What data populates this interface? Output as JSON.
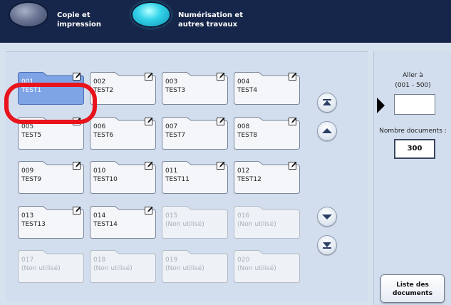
{
  "header": {
    "copy_tab": "Copie et\nimpression",
    "scan_tab": "Numérisation et\nautres travaux"
  },
  "folders": [
    {
      "num": "001",
      "name": "TEST1",
      "state": "selected"
    },
    {
      "num": "002",
      "name": "TEST2",
      "state": "used"
    },
    {
      "num": "003",
      "name": "TEST3",
      "state": "used"
    },
    {
      "num": "004",
      "name": "TEST4",
      "state": "used"
    },
    {
      "num": "005",
      "name": "TEST5",
      "state": "used"
    },
    {
      "num": "006",
      "name": "TEST6",
      "state": "used"
    },
    {
      "num": "007",
      "name": "TEST7",
      "state": "used"
    },
    {
      "num": "008",
      "name": "TEST8",
      "state": "used"
    },
    {
      "num": "009",
      "name": "TEST9",
      "state": "used"
    },
    {
      "num": "010",
      "name": "TEST10",
      "state": "used"
    },
    {
      "num": "011",
      "name": "TEST11",
      "state": "used"
    },
    {
      "num": "012",
      "name": "TEST12",
      "state": "used"
    },
    {
      "num": "013",
      "name": "TEST13",
      "state": "used"
    },
    {
      "num": "014",
      "name": "TEST14",
      "state": "used"
    },
    {
      "num": "015",
      "name": "(Non utilisé)",
      "state": "unused"
    },
    {
      "num": "016",
      "name": "(Non utilisé)",
      "state": "unused"
    },
    {
      "num": "017",
      "name": "(Non utilisé)",
      "state": "unused"
    },
    {
      "num": "018",
      "name": "(Non utilisé)",
      "state": "unused"
    },
    {
      "num": "019",
      "name": "(Non utilisé)",
      "state": "unused"
    },
    {
      "num": "020",
      "name": "(Non utilisé)",
      "state": "unused"
    }
  ],
  "right_panel": {
    "goto_label": "Aller à",
    "goto_range": "(001 - 500)",
    "count_label": "Nombre documents :",
    "count_value": "300",
    "list_button": "Liste des\ndocuments"
  },
  "colors": {
    "header_bg": "#16264a",
    "selected_folder": "#7fa4e6",
    "highlight": "#e8131b"
  },
  "icons": [
    "scroll-top-icon",
    "scroll-up-icon",
    "scroll-down-icon",
    "scroll-bottom-icon",
    "edit-icon"
  ]
}
